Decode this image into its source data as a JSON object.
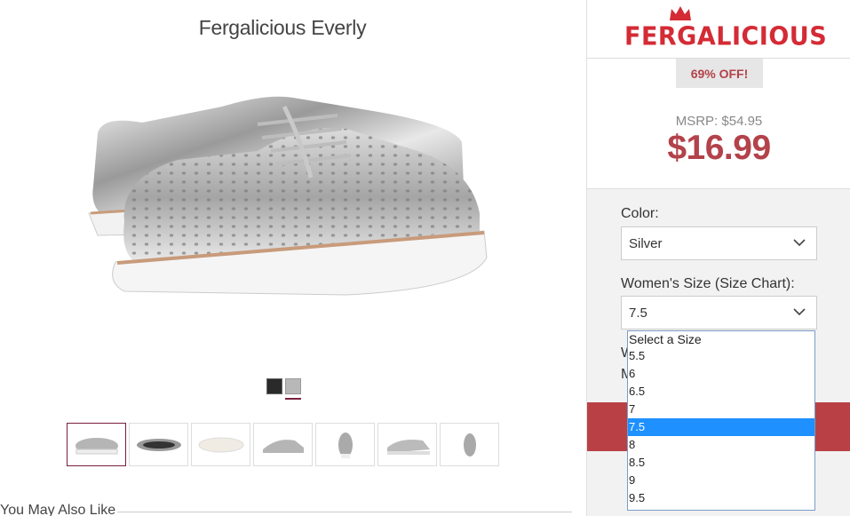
{
  "product": {
    "title": "Fergalicious Everly",
    "swatches": [
      {
        "name": "black",
        "color": "#2a2a2a"
      },
      {
        "name": "silver",
        "color": "#b8b8b8"
      }
    ],
    "thumbnail_count": 7
  },
  "also_like": "You May Also Like",
  "brand": {
    "logo_text": "FERGALICIOUS",
    "color": "#d42b35"
  },
  "pricing": {
    "discount_badge": "69% OFF!",
    "msrp": "MSRP: $54.95",
    "price": "$16.99",
    "price_color": "#b3424a"
  },
  "options": {
    "color_label": "Color:",
    "color_value": "Silver",
    "size_label": "Women's Size (Size Chart):",
    "size_value": "7.5",
    "hidden_line_1": "W",
    "hidden_line_2": "M"
  },
  "size_dropdown": {
    "options": [
      "Select a Size",
      "5.5",
      "6",
      "6.5",
      "7",
      "7.5",
      "8",
      "8.5",
      "9",
      "9.5"
    ],
    "selected": "7.5",
    "highlight_color": "#1e90ff"
  }
}
